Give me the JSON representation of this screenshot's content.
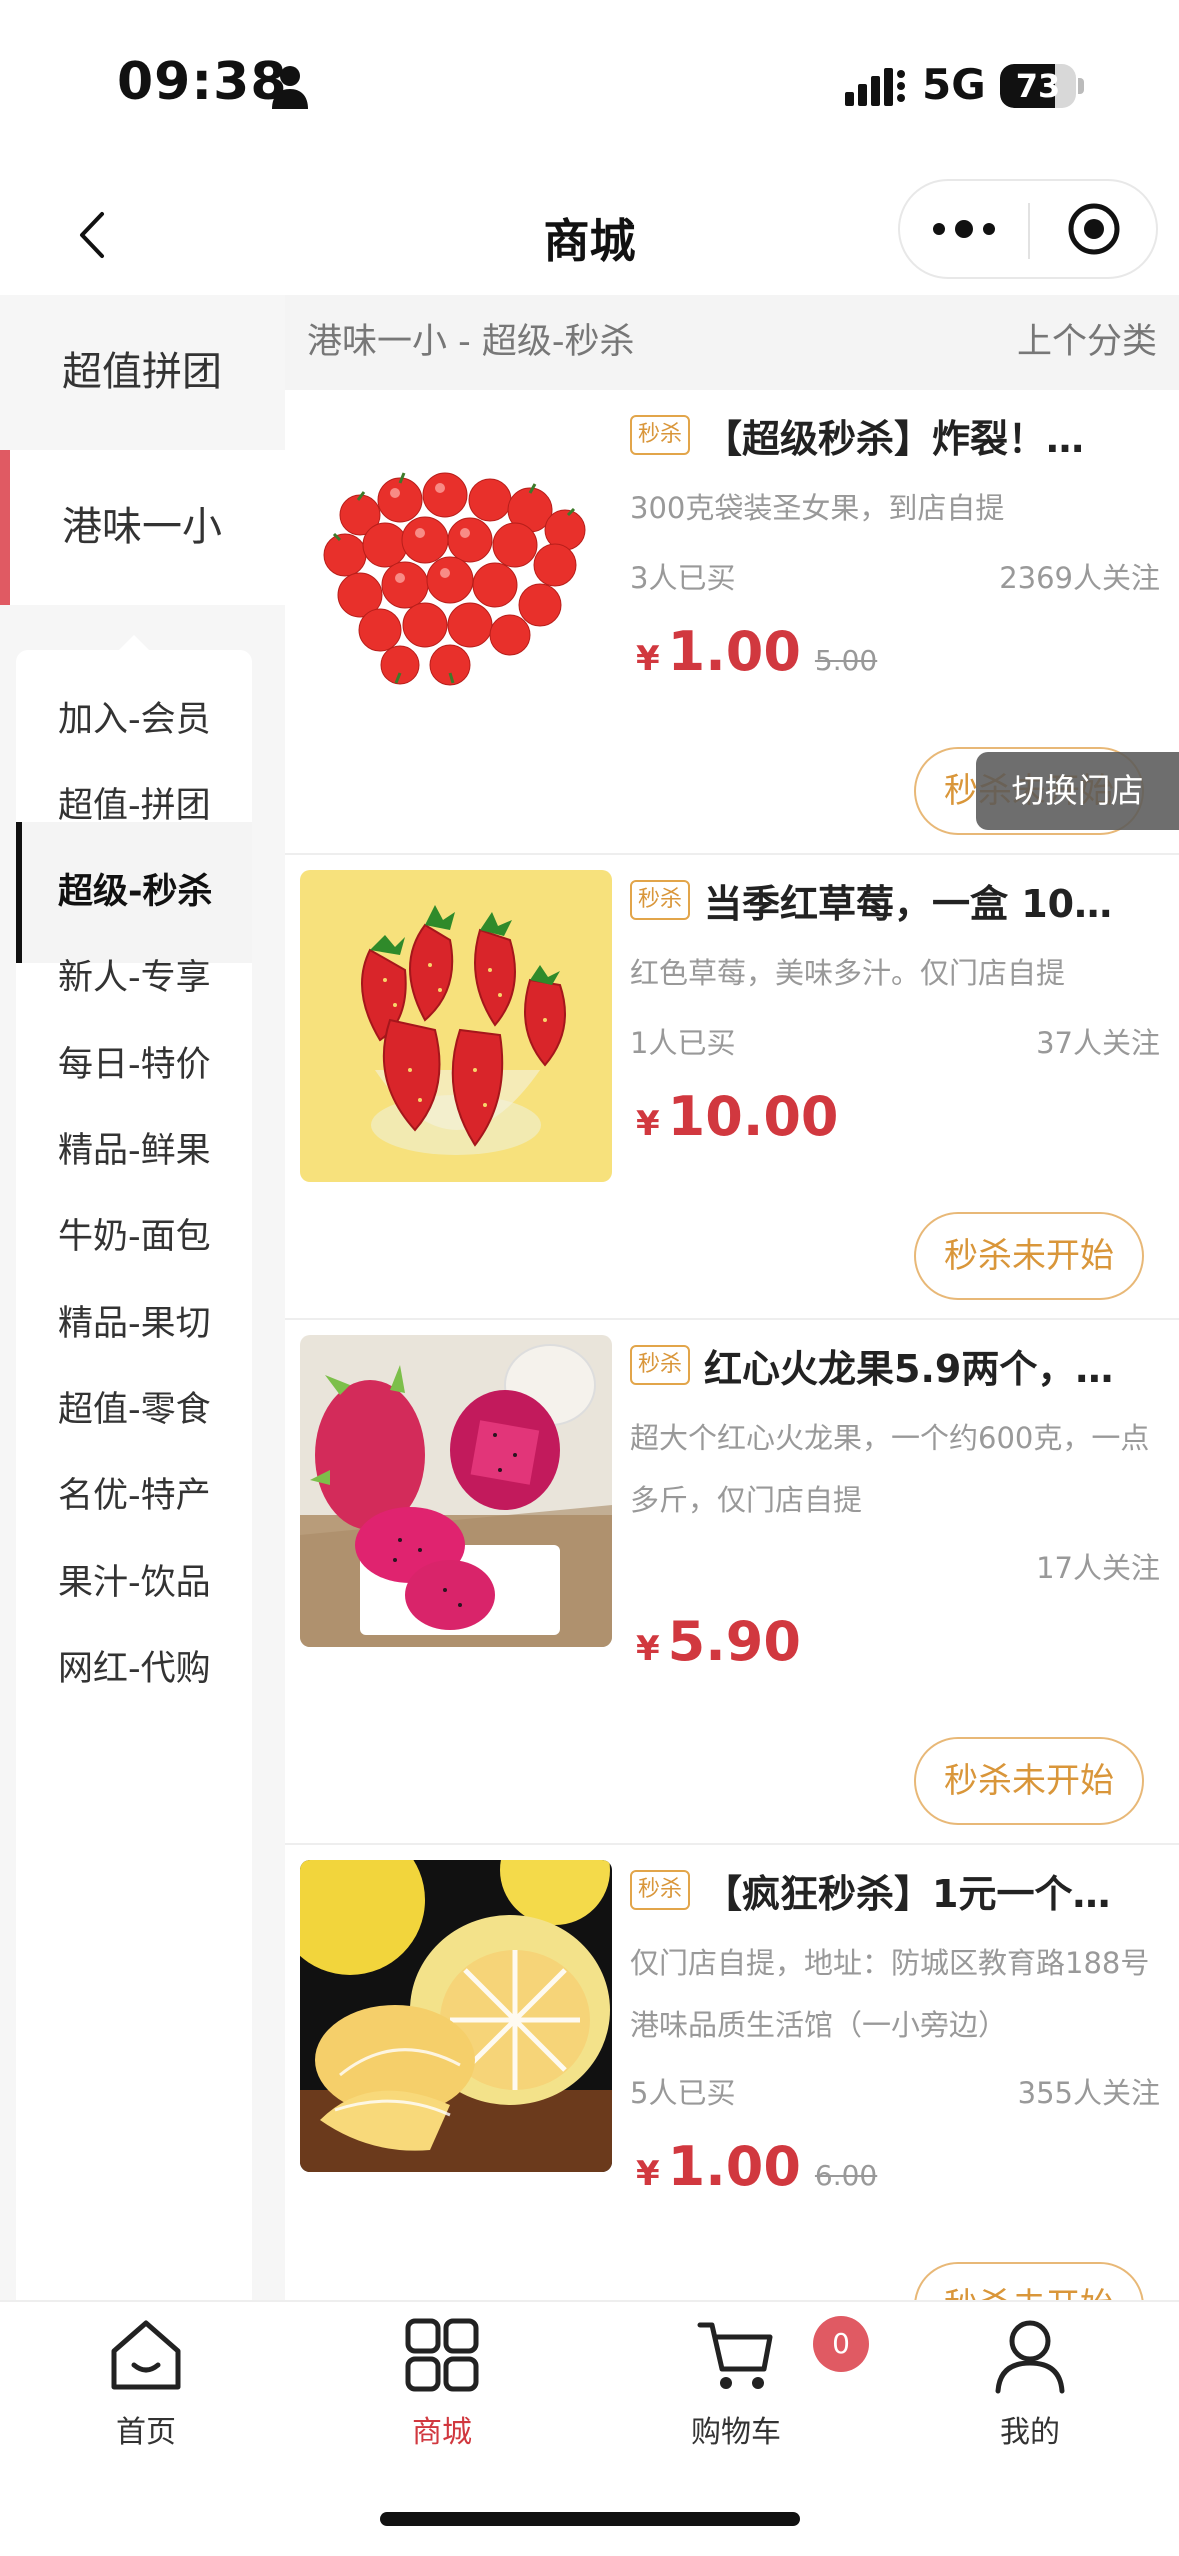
{
  "status_bar": {
    "time": "09:38",
    "network": "5G",
    "battery_level": "73",
    "battery_fraction": 0.73
  },
  "nav": {
    "title": "商城"
  },
  "sidebar": {
    "groups": [
      {
        "label": "超值拼团",
        "active": false
      },
      {
        "label": "港味一小",
        "active": true
      }
    ],
    "subcategories": [
      {
        "label": "加入-会员",
        "active": false
      },
      {
        "label": "超值-拼团",
        "active": false
      },
      {
        "label": "超级-秒杀",
        "active": true
      },
      {
        "label": "新人-专享",
        "active": false
      },
      {
        "label": "每日-特价",
        "active": false
      },
      {
        "label": "精品-鲜果",
        "active": false
      },
      {
        "label": "牛奶-面包",
        "active": false
      },
      {
        "label": "精品-果切",
        "active": false
      },
      {
        "label": "超值-零食",
        "active": false
      },
      {
        "label": "名优-特产",
        "active": false
      },
      {
        "label": "果汁-饮品",
        "active": false
      },
      {
        "label": "网红-代购",
        "active": false
      }
    ]
  },
  "content": {
    "breadcrumb": "港味一小 - 超级-秒杀",
    "prev_category": "上个分类",
    "currency_symbol": "¥",
    "products": [
      {
        "tag": "秒杀",
        "title": "【超级秒杀】炸裂！…",
        "description": "300克袋装圣女果，到店自提",
        "bought": "3人已买",
        "followers": "2369人关注",
        "price": "1.00",
        "original_price": "5.00",
        "action": "秒杀未开始",
        "image": "cherry-tomatoes"
      },
      {
        "tag": "秒杀",
        "title": "当季红草莓，一盒 10…",
        "description": "红色草莓，美味多汁。仅门店自提",
        "bought": "1人已买",
        "followers": "37人关注",
        "price": "10.00",
        "original_price": "",
        "action": "秒杀未开始",
        "image": "strawberries"
      },
      {
        "tag": "秒杀",
        "title": "红心火龙果5.9两个，…",
        "description": "超大个红心火龙果，一个约600克，一点多斤，仅门店自提",
        "bought": "",
        "followers": "17人关注",
        "price": "5.90",
        "original_price": "",
        "action": "秒杀未开始",
        "image": "dragon-fruit"
      },
      {
        "tag": "秒杀",
        "title": "【疯狂秒杀】1元一个…",
        "description": "仅门店自提，地址：防城区教育路188号港味品质生活馆（一小旁边）",
        "bought": "5人已买",
        "followers": "355人关注",
        "price": "1.00",
        "original_price": "6.00",
        "action": "秒杀未开始",
        "image": "grapefruit"
      }
    ]
  },
  "floating": {
    "switch_store": "切换门店"
  },
  "tab_bar": {
    "items": [
      {
        "label": "首页",
        "icon": "home-icon",
        "active": false
      },
      {
        "label": "商城",
        "icon": "grid-icon",
        "active": true
      },
      {
        "label": "购物车",
        "icon": "cart-icon",
        "active": false
      },
      {
        "label": "我的",
        "icon": "user-icon",
        "active": false
      }
    ],
    "cart_count": "0"
  },
  "colors": {
    "accent_red": "#d1383f",
    "seckill_orange": "#d9963a",
    "sidebar_marker": "#e05a63"
  }
}
